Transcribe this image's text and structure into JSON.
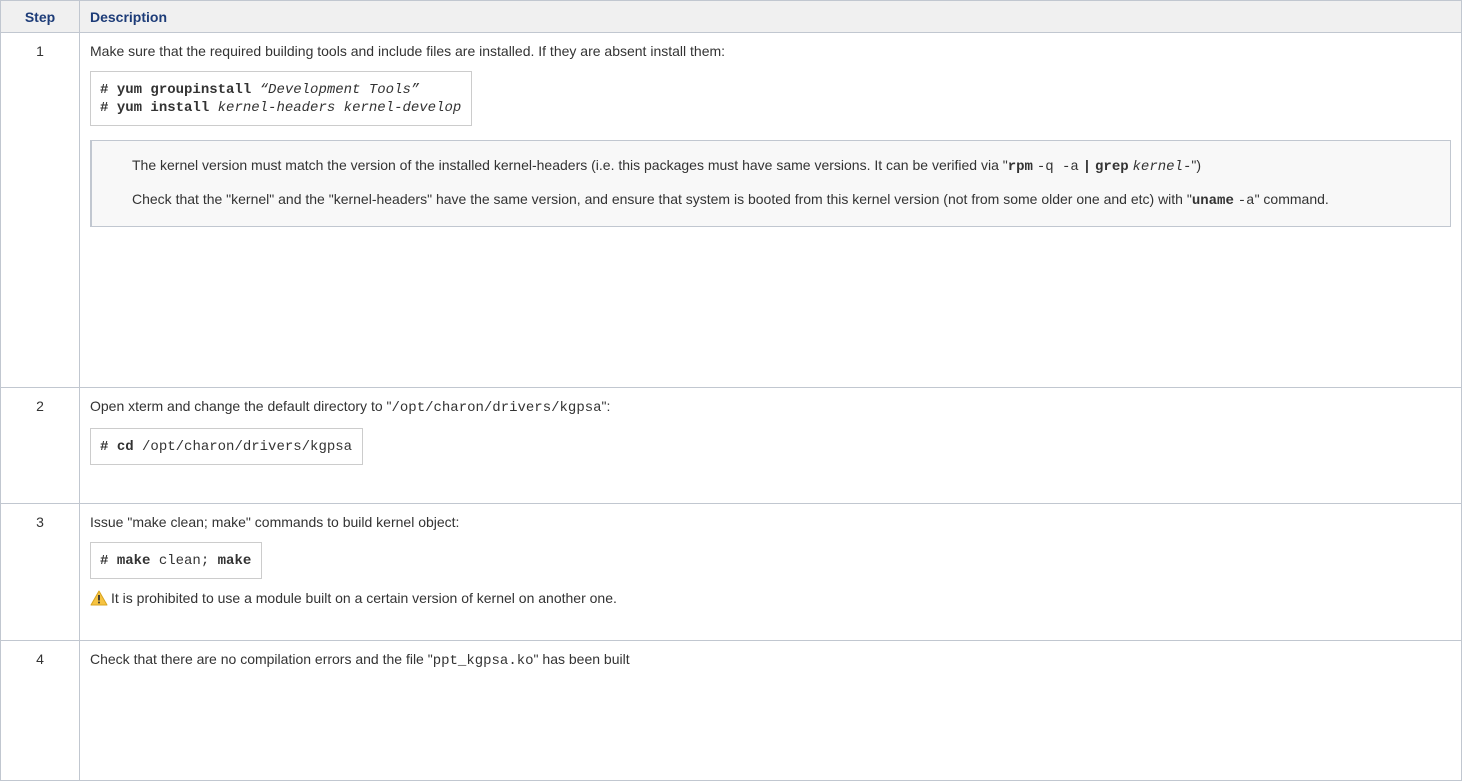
{
  "header": {
    "step": "Step",
    "description": "Description"
  },
  "rows": [
    {
      "num": "1",
      "text": "Make sure that the required building tools and include files are installed. If they are absent install them:",
      "code": {
        "l1_prompt": "#",
        "l1_cmd": "yum groupinstall",
        "l1_arg": "“Development Tools”",
        "l2_prompt": "#",
        "l2_cmd": "yum install",
        "l2_arg": "kernel-headers kernel-develop"
      },
      "note": {
        "p1_text": "The kernel version must match the version of the installed kernel-headers (i.e. this packages must have same versions. It can be verified via \"",
        "p1_cmd1": "rpm",
        "p1_opts": "-q -a",
        "p1_pipe": "|",
        "p1_cmd2": "grep",
        "p1_arg": "kernel-",
        "p1_end": "\")",
        "p2_text": "Check that the \"kernel\" and the \"kernel-headers\" have the same version, and ensure that system is booted from this kernel version (not from some older one and etc) with \"",
        "p2_cmd": "uname",
        "p2_opt": "-a",
        "p2_end": "\" command."
      }
    },
    {
      "num": "2",
      "text_before": "Open xterm and change the default directory to \"",
      "path": "/opt/charon/drivers/kgpsa",
      "text_after": "\":",
      "code": {
        "prompt": "#",
        "cmd": "cd",
        "arg": "/opt/charon/drivers/kgpsa"
      }
    },
    {
      "num": "3",
      "text": "Issue \"make clean; make\" commands to build kernel object:",
      "code": {
        "prompt": "#",
        "cmd1": "make",
        "arg": "clean;",
        "cmd2": "make"
      },
      "warning_icon": "warning-triangle-icon",
      "warning": "It is prohibited to use a module built on a certain version of kernel on another one."
    },
    {
      "num": "4",
      "text_before": "Check that there are no compilation errors and the file \"",
      "file": "ppt_kgpsa.ko",
      "text_after": "\" has been built"
    }
  ],
  "colors": {
    "header_text": "#1d3c78",
    "header_bg": "#f0f0f0",
    "border": "#c1c7d0",
    "warning": "#f6c342"
  }
}
